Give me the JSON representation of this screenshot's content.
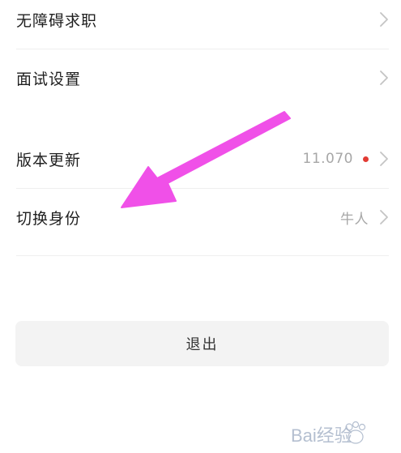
{
  "settings": {
    "items": [
      {
        "label": "无障碍求职",
        "value": "",
        "has_badge": false
      },
      {
        "label": "面试设置",
        "value": "",
        "has_badge": false
      },
      {
        "label": "版本更新",
        "value": "11.070",
        "has_badge": true
      },
      {
        "label": "切换身份",
        "value": "牛人",
        "has_badge": false
      }
    ]
  },
  "actions": {
    "logout_label": "退出"
  },
  "annotation": {
    "arrow_color": "#f050e8"
  },
  "watermark": {
    "text": "Bai经验"
  }
}
